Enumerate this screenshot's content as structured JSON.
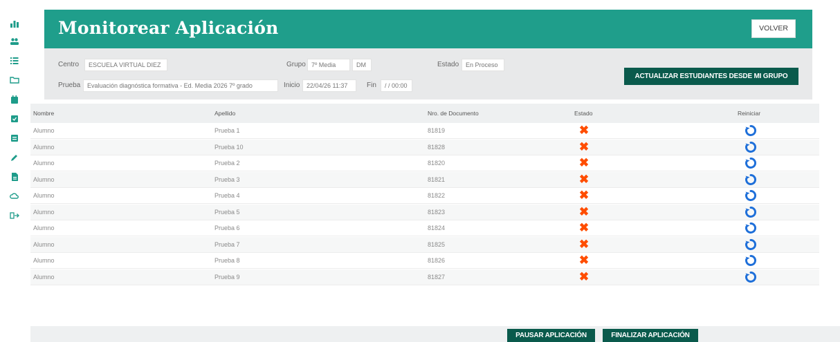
{
  "header": {
    "title": "Monitorear Aplicación",
    "back_label": "VOLVER"
  },
  "sidebar": {
    "icons": [
      "home-icon",
      "users-icon",
      "list-icon",
      "folder-icon",
      "calendar-icon",
      "check-icon",
      "book-icon",
      "edit-icon",
      "document-icon",
      "cloud-icon",
      "logout-icon"
    ]
  },
  "filters": {
    "centro_label": "Centro",
    "centro_value": "ESCUELA VIRTUAL DIEZ",
    "grupo_label": "Grupo",
    "grupo_value": "7º Media",
    "grupo_section": "DM",
    "estado_label": "Estado",
    "estado_value": "En Proceso",
    "prueba_label": "Prueba",
    "prueba_value": "Evaluación diagnóstica formativa - Ed. Media 2026 7º grado",
    "inicio_label": "Inicio",
    "inicio_value": "22/04/26 11:37",
    "fin_label": "Fin",
    "fin_value": "/ / 00:00",
    "update_label": "ACTUALIZAR ESTUDIANTES DESDE MI GRUPO"
  },
  "table": {
    "headers": {
      "nombre": "Nombre",
      "apellido": "Apellido",
      "documento": "Nro. de Documento",
      "estado": "Estado",
      "reiniciar": "Reiniciar"
    },
    "rows": [
      {
        "nombre": "Alumno",
        "apellido": "Prueba 1",
        "documento": "81819"
      },
      {
        "nombre": "Alumno",
        "apellido": "Prueba 10",
        "documento": "81828"
      },
      {
        "nombre": "Alumno",
        "apellido": "Prueba 2",
        "documento": "81820"
      },
      {
        "nombre": "Alumno",
        "apellido": "Prueba 3",
        "documento": "81821"
      },
      {
        "nombre": "Alumno",
        "apellido": "Prueba 4",
        "documento": "81822"
      },
      {
        "nombre": "Alumno",
        "apellido": "Prueba 5",
        "documento": "81823"
      },
      {
        "nombre": "Alumno",
        "apellido": "Prueba 6",
        "documento": "81824"
      },
      {
        "nombre": "Alumno",
        "apellido": "Prueba 7",
        "documento": "81825"
      },
      {
        "nombre": "Alumno",
        "apellido": "Prueba 8",
        "documento": "81826"
      },
      {
        "nombre": "Alumno",
        "apellido": "Prueba 9",
        "documento": "81827"
      }
    ]
  },
  "actions": {
    "pause_label": "PAUSAR APLICACIÓN",
    "finish_label": "FINALIZAR APLICACIÓN"
  },
  "colors": {
    "brand": "#1f9e8b",
    "dark_button": "#0a5a4c",
    "state_icon": "#ff4d00",
    "restart_icon": "#1e6fd9"
  }
}
